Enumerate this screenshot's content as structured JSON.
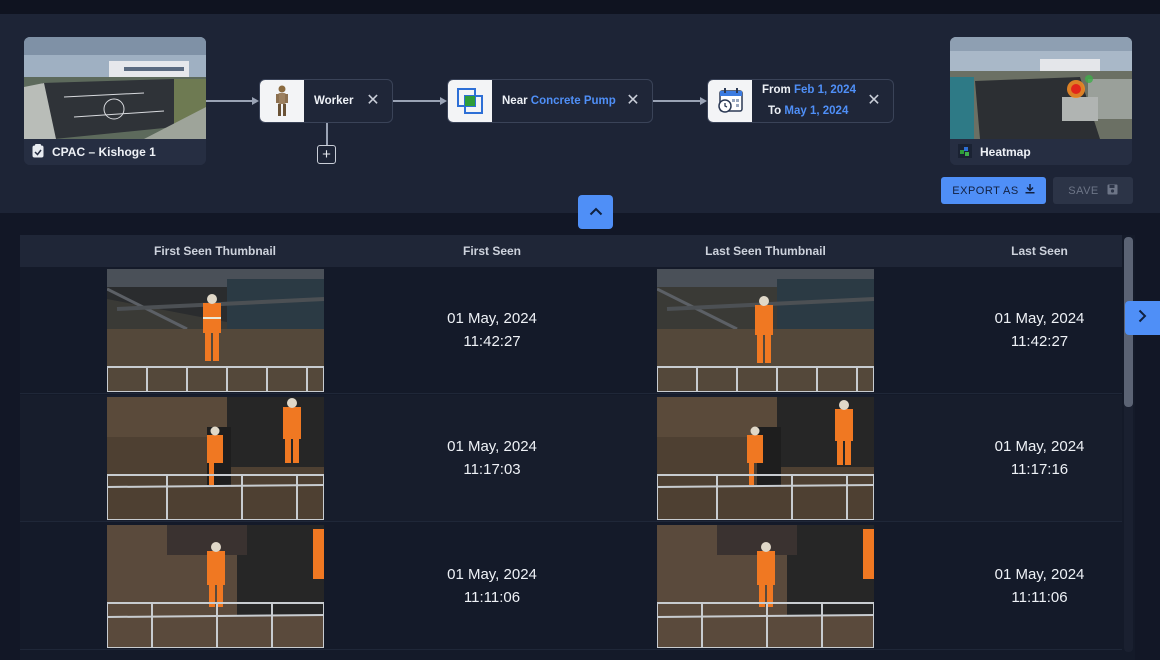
{
  "query": {
    "source_camera": {
      "name": "CPAC – Kishoge 1",
      "icon": "site-badge-icon"
    },
    "nodes": [
      {
        "type": "object",
        "label": "Worker",
        "icon": "worker-icon"
      },
      {
        "type": "proximity",
        "prefix": "Near",
        "value": "Concrete Pump",
        "icon": "overlap-squares-icon"
      },
      {
        "type": "date-range",
        "from_label": "From",
        "from_value": "Feb 1, 2024",
        "to_label": "To",
        "to_value": "May 1, 2024",
        "icon": "calendar-clock-icon"
      }
    ],
    "add_symbol": "+",
    "close_symbol": "✕",
    "output": {
      "name": "Heatmap",
      "icon": "heatmap-icon"
    },
    "actions": {
      "export_label": "EXPORT AS",
      "save_label": "SAVE"
    }
  },
  "table": {
    "columns": [
      "First Seen Thumbnail",
      "First Seen",
      "Last Seen Thumbnail",
      "Last Seen"
    ],
    "rows": [
      {
        "first_date": "01 May, 2024",
        "first_time": "11:42:27",
        "last_date": "01 May, 2024",
        "last_time": "11:42:27"
      },
      {
        "first_date": "01 May, 2024",
        "first_time": "11:17:03",
        "last_date": "01 May, 2024",
        "last_time": "11:17:16"
      },
      {
        "first_date": "01 May, 2024",
        "first_time": "11:11:06",
        "last_date": "01 May, 2024",
        "last_time": "11:11:06"
      }
    ]
  },
  "colors": {
    "accent": "#4f8ff7",
    "background": "#121726",
    "panel": "#1d2436"
  }
}
